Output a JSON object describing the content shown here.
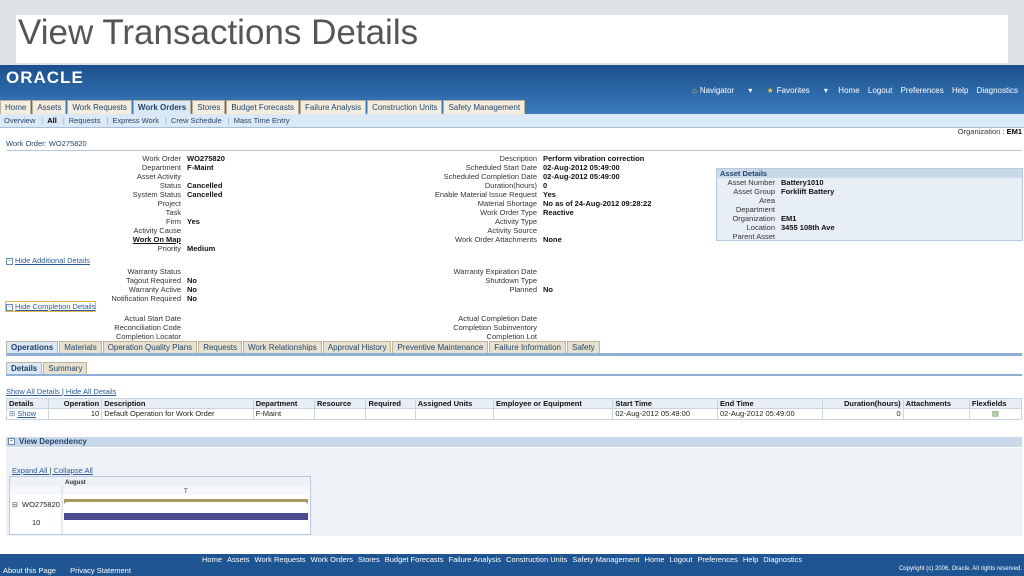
{
  "slide_title": "View Transactions Details",
  "brand": {
    "logo": "ORACLE"
  },
  "global_links": {
    "navigator": "Navigator",
    "favorites": "Favorites",
    "items": [
      "Home",
      "Logout",
      "Preferences",
      "Help",
      "Diagnostics"
    ]
  },
  "tabs": [
    {
      "label": "Home",
      "active": false
    },
    {
      "label": "Assets",
      "active": false
    },
    {
      "label": "Work Requests",
      "active": false
    },
    {
      "label": "Work Orders",
      "active": true
    },
    {
      "label": "Stores",
      "active": false
    },
    {
      "label": "Budget Forecasts",
      "active": false
    },
    {
      "label": "Failure Analysis",
      "active": false
    },
    {
      "label": "Construction Units",
      "active": false
    },
    {
      "label": "Safety Management",
      "active": false
    }
  ],
  "subnav": [
    "Overview",
    "All",
    "Requests",
    "Express Work",
    "Crew Schedule",
    "Mass Time Entry"
  ],
  "org": {
    "label": "Organization :",
    "value": "EM1"
  },
  "work_order_header": "Work Order: WO275820",
  "left_fields": [
    {
      "label": "Work Order",
      "value": "WO275820"
    },
    {
      "label": "Department",
      "value": "F-Maint"
    },
    {
      "label": "Asset Activity",
      "value": ""
    },
    {
      "label": "Status",
      "value": "Cancelled"
    },
    {
      "label": "System Status",
      "value": "Cancelled"
    },
    {
      "label": "Project",
      "value": ""
    },
    {
      "label": "Task",
      "value": ""
    },
    {
      "label": "Firm",
      "value": "Yes"
    },
    {
      "label": "Activity Cause",
      "value": ""
    },
    {
      "label": "Work On Map",
      "value": ""
    },
    {
      "label": "Priority",
      "value": "Medium"
    }
  ],
  "right_fields": [
    {
      "label": "Description",
      "value": "Perform vibration correction"
    },
    {
      "label": "Scheduled Start Date",
      "value": "02-Aug-2012 05:49:00"
    },
    {
      "label": "Scheduled Completion Date",
      "value": "02-Aug-2012 05:49:00"
    },
    {
      "label": "Duration(hours)",
      "value": "0"
    },
    {
      "label": "Enable Material Issue Request",
      "value": "Yes"
    },
    {
      "label": "Material Shortage",
      "value": "No as of 24-Aug-2012 09:28:22"
    },
    {
      "label": "Work Order Type",
      "value": "Reactive"
    },
    {
      "label": "Activity Type",
      "value": ""
    },
    {
      "label": "Activity Source",
      "value": ""
    },
    {
      "label": "Work Order Attachments",
      "value": "None"
    }
  ],
  "asset_details": {
    "title": "Asset Details",
    "fields": [
      {
        "label": "Asset Number",
        "value": "Battery1010"
      },
      {
        "label": "Asset Group",
        "value": "Forklift Battery"
      },
      {
        "label": "Area",
        "value": ""
      },
      {
        "label": "Department",
        "value": ""
      },
      {
        "label": "Organization",
        "value": "EM1"
      },
      {
        "label": "Location",
        "value": "3455 108th Ave"
      },
      {
        "label": "Parent Asset",
        "value": ""
      }
    ]
  },
  "hide_additional": "Hide Additional Details",
  "additional_left": [
    {
      "label": "Warranty Status",
      "value": ""
    },
    {
      "label": "Tagout Required",
      "value": "No"
    },
    {
      "label": "Warranty Active",
      "value": "No"
    },
    {
      "label": "Notification Required",
      "value": "No"
    }
  ],
  "additional_right": [
    {
      "label": "Warranty Expiration Date",
      "value": ""
    },
    {
      "label": "Shutdown Type",
      "value": ""
    },
    {
      "label": "Planned",
      "value": "No"
    }
  ],
  "hide_completion": "Hide Completion Details",
  "completion_left": [
    {
      "label": "Actual Start Date",
      "value": ""
    },
    {
      "label": "Reconciliation Code",
      "value": ""
    },
    {
      "label": "Completion Locator",
      "value": ""
    }
  ],
  "completion_right": [
    {
      "label": "Actual Completion Date",
      "value": ""
    },
    {
      "label": "Completion Subinventory",
      "value": ""
    },
    {
      "label": "Completion Lot",
      "value": ""
    }
  ],
  "sub_tabs": [
    "Operations",
    "Materials",
    "Operation Quality Plans",
    "Requests",
    "Work Relationships",
    "Approval History",
    "Preventive Maintenance",
    "Failure Information",
    "Safety"
  ],
  "sub_tabs2": [
    "Details",
    "Summary"
  ],
  "ops_links": {
    "show_all": "Show All Details",
    "hide_all": "Hide All Details"
  },
  "ops_table": {
    "headers": [
      "Details",
      "Operation",
      "Description",
      "Department",
      "Resource",
      "Required",
      "Assigned Units",
      "Employee or Equipment",
      "Start Time",
      "End Time",
      "Duration(hours)",
      "Attachments",
      "Flexfields"
    ],
    "rows": [
      {
        "details": "Show",
        "operation": "10",
        "description": "Default Operation for Work Order",
        "department": "F-Maint",
        "resource": "",
        "required": "",
        "assigned": "",
        "employee": "",
        "start": "02-Aug-2012 05:49:00",
        "end": "02-Aug-2012 05:49:00",
        "duration": "0",
        "attachments": ""
      }
    ]
  },
  "dependency": {
    "title": "View Dependency",
    "expand_all": "Expand All",
    "collapse_all": "Collapse All",
    "month": "August",
    "day": "T",
    "wo": "WO275820",
    "op": "10"
  },
  "footer": {
    "links": [
      "Home",
      "Assets",
      "Work Requests",
      "Work Orders",
      "Stores",
      "Budget Forecasts",
      "Failure Analysis",
      "Construction Units",
      "Safety Management",
      "Home",
      "Logout",
      "Preferences",
      "Help",
      "Diagnostics"
    ],
    "about": "About this Page",
    "privacy": "Privacy Statement",
    "copyright": "Copyright (c) 2006, Oracle. All rights reserved."
  }
}
